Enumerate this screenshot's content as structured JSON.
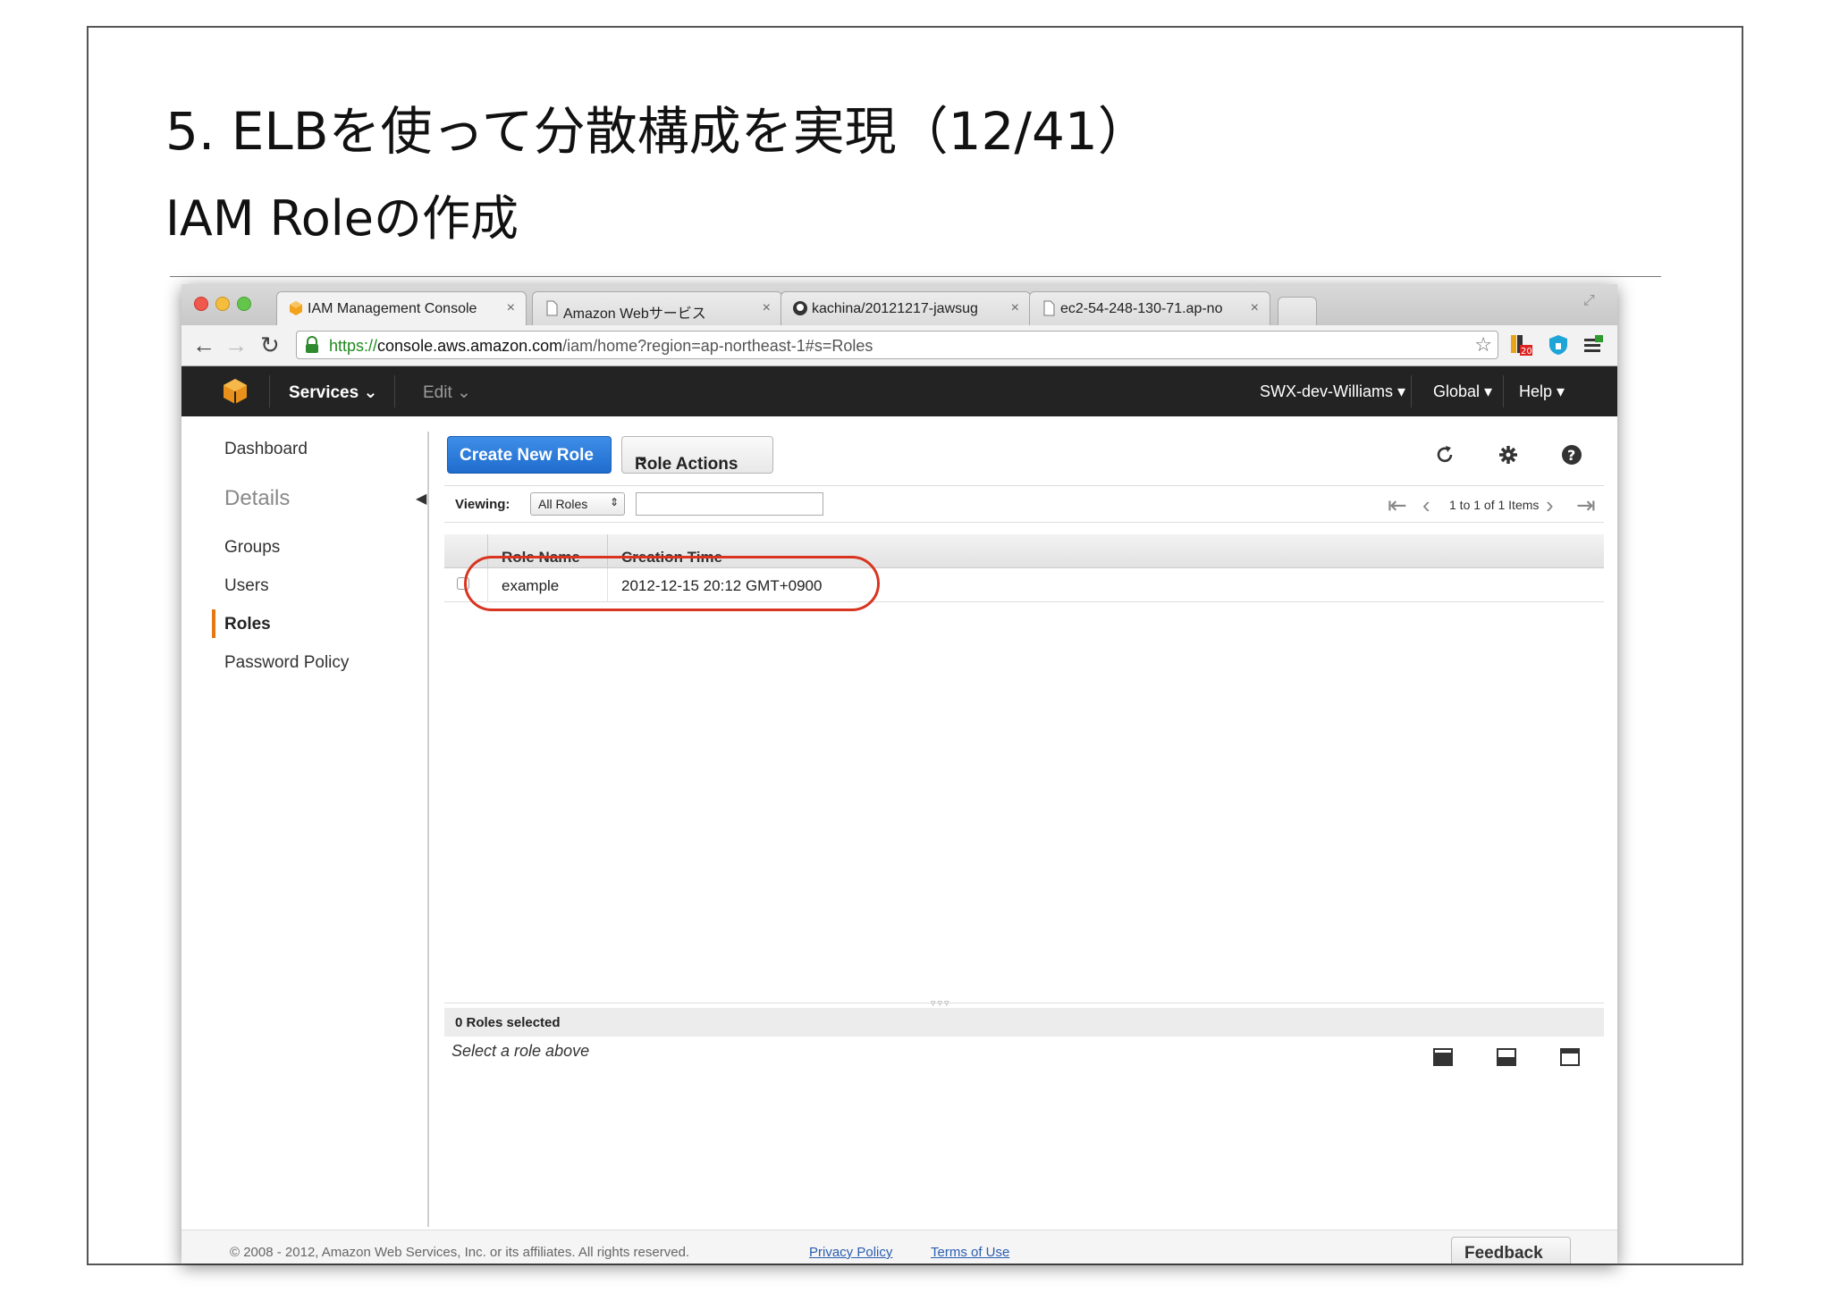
{
  "slide": {
    "title": "5. ELBを使って分散構成を実現（12/41）",
    "subtitle": "IAM Roleの作成"
  },
  "browser": {
    "tabs": [
      {
        "label": "IAM Management Console",
        "icon": "aws-cube-icon",
        "active": true
      },
      {
        "label": "Amazon Webサービス",
        "icon": "page-icon",
        "active": false
      },
      {
        "label": "kachina/20121217-jawsug",
        "icon": "github-icon",
        "active": false
      },
      {
        "label": "ec2-54-248-130-71.ap-no",
        "icon": "page-icon",
        "active": false
      }
    ],
    "url": {
      "scheme": "https://",
      "host": "console.aws.amazon.com",
      "path": "/iam/home?region=ap-northeast-1#s=Roles"
    },
    "extension_badge": "20"
  },
  "aws_header": {
    "services": "Services",
    "edit": "Edit",
    "account": "SWX-dev-Williams",
    "region": "Global",
    "help": "Help"
  },
  "sidebar": {
    "dashboard": "Dashboard",
    "section": "Details",
    "items": [
      "Groups",
      "Users",
      "Roles",
      "Password Policy"
    ],
    "active": "Roles"
  },
  "main": {
    "create_button": "Create New Role",
    "actions_button": "Role Actions",
    "viewing_label": "Viewing:",
    "viewing_value": "All Roles",
    "filter_value": "",
    "pagination": "1 to 1 of 1 Items",
    "columns": [
      "Role Name",
      "Creation Time"
    ],
    "rows": [
      {
        "role_name": "example",
        "creation_time": "2012-12-15 20:12 GMT+0900"
      }
    ],
    "selected_count": "0 Roles selected",
    "detail_empty": "Select a role above"
  },
  "footer": {
    "copyright": "© 2008 - 2012, Amazon Web Services, Inc. or its affiliates. All rights reserved.",
    "privacy": "Privacy Policy",
    "terms": "Terms of Use",
    "feedback": "Feedback"
  },
  "colors": {
    "primary_button": "#1f6ccd",
    "header_bg": "#232323",
    "active_accent": "#e47911",
    "highlight_oval": "#d9341f"
  }
}
